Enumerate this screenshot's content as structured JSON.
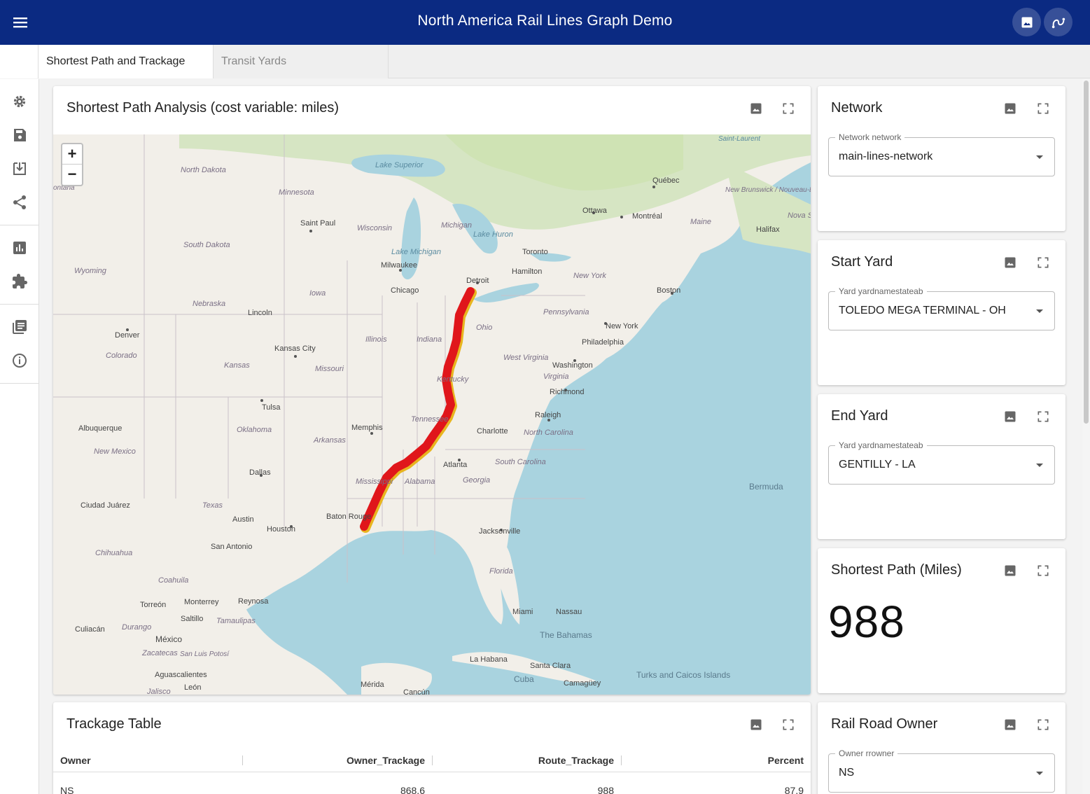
{
  "app": {
    "title": "North America Rail Lines Graph Demo",
    "header_buttons": [
      "image-icon",
      "graph-icon"
    ]
  },
  "tabs": [
    {
      "label": "Shortest Path and Trackage",
      "active": true
    },
    {
      "label": "Transit Yards",
      "active": false
    }
  ],
  "sidebar": {
    "items": [
      "gear-icon",
      "save-icon",
      "download-icon",
      "share-icon",
      "chart-icon",
      "extension-icon",
      "list-icon",
      "info-icon"
    ]
  },
  "map_card": {
    "title": "Shortest Path Analysis (cost variable: miles)",
    "zoom_in": "+",
    "zoom_out": "−",
    "labels": {
      "cities": [
        "North Dakota",
        "Minnesota",
        "Saint Paul",
        "Wisconsin",
        "Michigan",
        "Lake Superior",
        "Lake Huron",
        "Lake Michigan",
        "South Dakota",
        "Wyoming",
        "Milwaukee",
        "Toronto",
        "Hamilton",
        "Detroit",
        "Chicago",
        "Iowa",
        "Nebraska",
        "Lincoln",
        "Denver",
        "Colorado",
        "Kansas City",
        "Kansas",
        "Illinois",
        "Indiana",
        "Ohio",
        "Missouri",
        "Kentucky",
        "West Virginia",
        "Virginia",
        "Washington",
        "Richmond",
        "Pennsylvania",
        "New York",
        "Philadelphia",
        "Boston",
        "New York ",
        "Ottawa",
        "Montréal",
        "Québec",
        "Maine",
        "Halifax",
        "Nova Sc",
        "New Brunswick / Nouveau-Brunswick",
        "Saint-Laurent",
        "Tulsa",
        "Oklahoma",
        "Albuquerque",
        "New Mexico",
        "Memphis",
        "Arkansas",
        "Tennessee",
        "Raleigh",
        "North Carolina",
        "Charlotte",
        "Atlanta",
        "South Carolina",
        "Georgia",
        "Alabama",
        "Mississippi",
        "Dallas",
        "Texas",
        "Ciudad Juárez",
        "Austin",
        "Houston",
        "San Antonio",
        "Baton Rouge",
        "Jacksonville",
        "Florida",
        "Miami",
        "Nassau",
        "The Bahamas",
        "Bermuda",
        "Chihuahua",
        "Coahuila",
        "Torreón",
        "Monterrey",
        "Reynosa",
        "Saltillo",
        "Tamaulipas",
        "Culiacán",
        "Durango",
        "México",
        "Zacatecas",
        "San Luis Potosí",
        "Aguascalientes",
        "León",
        "Jalisco",
        "Mérida",
        "Cancún",
        "La Habana",
        "Santa Clara",
        "Cuba",
        "Camagüey",
        "Turks and Caicos Islands",
        "ontana"
      ]
    }
  },
  "network_card": {
    "title": "Network",
    "field_label": "Network network",
    "value": "main-lines-network"
  },
  "start_card": {
    "title": "Start Yard",
    "field_label": "Yard yardnamestateab",
    "value": "TOLEDO MEGA TERMINAL - OH"
  },
  "end_card": {
    "title": "End Yard",
    "field_label": "Yard yardnamestateab",
    "value": "GENTILLY - LA"
  },
  "shortest_card": {
    "title": "Shortest Path (Miles)",
    "value": "988"
  },
  "trackage_card": {
    "title": "Trackage Table",
    "columns": [
      "Owner",
      "Owner_Trackage",
      "Route_Trackage",
      "Percent"
    ],
    "rows": [
      {
        "Owner": "NS",
        "Owner_Trackage": "868.6",
        "Route_Trackage": "988",
        "Percent": "87.9"
      }
    ]
  },
  "owner_card": {
    "title": "Rail Road Owner",
    "field_label": "Owner rrowner",
    "value": "NS"
  },
  "colors": {
    "appbar": "#0b2a82",
    "route": "#e0161b",
    "water": "#a9d3df",
    "land": "#f2efe9",
    "forest": "#cfe3b4"
  }
}
